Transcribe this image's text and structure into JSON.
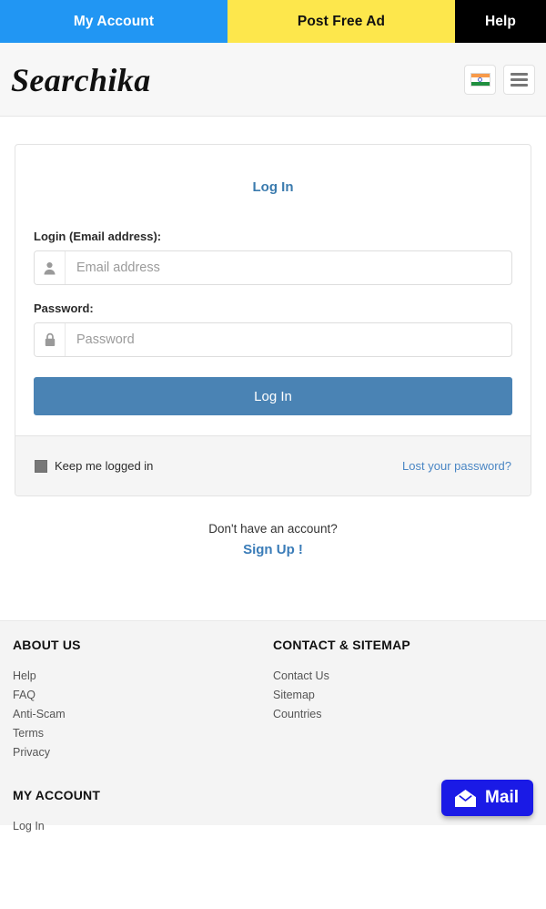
{
  "topnav": {
    "my_account": "My Account",
    "post_free_ad": "Post Free Ad",
    "help": "Help",
    "colors": {
      "my_account_bg": "#2196f3",
      "post_free_ad_bg": "#fde74c",
      "help_bg": "#000000"
    }
  },
  "header": {
    "logo": "Searchika",
    "flag_icon": "india-flag-icon",
    "menu_icon": "hamburger-menu-icon"
  },
  "login_card": {
    "title": "Log In",
    "email": {
      "label": "Login (Email address):",
      "placeholder": "Email address",
      "value": "",
      "icon": "user-icon"
    },
    "password": {
      "label": "Password:",
      "placeholder": "Password",
      "value": "",
      "icon": "lock-icon"
    },
    "submit_label": "Log In",
    "submit_color": "#4a83b4",
    "keep_logged_in": "Keep me logged in",
    "lost_password": "Lost your password?"
  },
  "signup": {
    "question": "Don't have an account?",
    "link": "Sign Up !"
  },
  "footer": {
    "about": {
      "heading": "ABOUT US",
      "links": [
        "Help",
        "FAQ",
        "Anti-Scam",
        "Terms",
        "Privacy"
      ]
    },
    "contact": {
      "heading": "CONTACT & SITEMAP",
      "links": [
        "Contact Us",
        "Sitemap",
        "Countries"
      ]
    },
    "my_account": {
      "heading": "MY ACCOUNT",
      "links": [
        "Log In"
      ]
    }
  },
  "mail_button": {
    "label": "Mail",
    "icon": "envelope-icon",
    "color": "#1a1ae6"
  }
}
